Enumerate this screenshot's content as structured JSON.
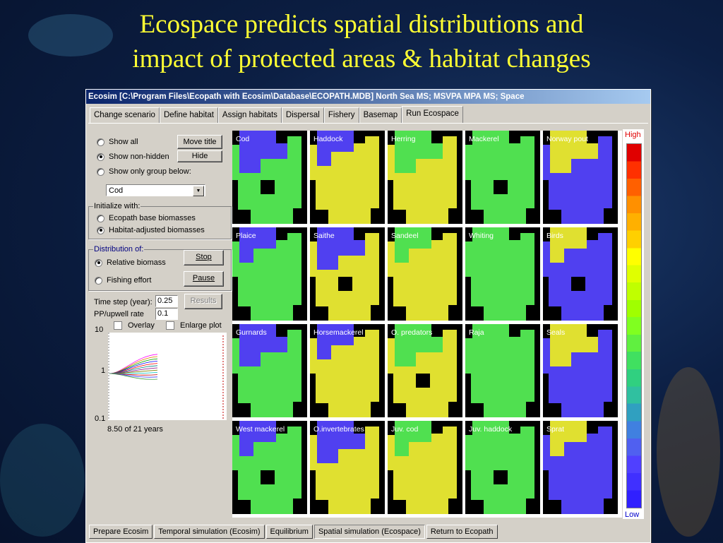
{
  "slide_title": [
    "Ecospace predicts spatial distributions and",
    "impact of protected areas & habitat changes"
  ],
  "window": {
    "title": "Ecosim [C:\\Program Files\\Ecopath with Ecosim\\Database\\ECOPATH.MDB] North Sea MS; MSVPA MPA MS; Space"
  },
  "tabs": [
    {
      "label": "Change scenario",
      "active": false
    },
    {
      "label": "Define habitat",
      "active": false
    },
    {
      "label": "Assign habitats",
      "active": false
    },
    {
      "label": "Dispersal",
      "active": false
    },
    {
      "label": "Fishery",
      "active": false
    },
    {
      "label": "Basemap",
      "active": false
    },
    {
      "label": "Run Ecospace",
      "active": true
    }
  ],
  "display_options": {
    "show_all": "Show all",
    "show_non_hidden": "Show non-hidden",
    "show_only_group": "Show only group below:",
    "selected": "show_non_hidden",
    "move_title_button": "Move title",
    "hide_button": "Hide",
    "group_value": "Cod"
  },
  "initialize": {
    "label": "Initialize with:",
    "ecopath_base": "Ecopath base biomasses",
    "habitat_adjusted": "Habitat-adjusted biomasses",
    "selected": "habitat_adjusted"
  },
  "distribution": {
    "label": "Distribution of:",
    "relative_biomass": "Relative biomass",
    "fishing_effort": "Fishing effort",
    "selected": "relative_biomass",
    "stop_button": "Stop",
    "pause_button": "Pause"
  },
  "params": {
    "time_step_label": "Time step (year):",
    "time_step_value": "0.25",
    "pp_label": "PP/upwell rate",
    "pp_value": "0.1",
    "results_button": "Results"
  },
  "plot": {
    "overlay_label": "Overlay",
    "enlarge_label": "Enlarge plot",
    "y_ticks": [
      "10",
      "1",
      "0.1"
    ],
    "status": "8.50 of 21 years",
    "line_colors": [
      "#ff00ff",
      "#e08000",
      "#00a000",
      "#0000ff",
      "#ff0000",
      "#008080",
      "#800080",
      "#808000",
      "#00c0c0",
      "#c00000",
      "#4040ff",
      "#40a040"
    ]
  },
  "maps": [
    {
      "name": "Cod"
    },
    {
      "name": "Haddock"
    },
    {
      "name": "Herring"
    },
    {
      "name": "Mackerel"
    },
    {
      "name": "Norway pout"
    },
    {
      "name": "Plaice"
    },
    {
      "name": "Saithe"
    },
    {
      "name": "Sandeel"
    },
    {
      "name": "Whiting"
    },
    {
      "name": "Birds"
    },
    {
      "name": "Gurnards"
    },
    {
      "name": "Horsemackerel"
    },
    {
      "name": "O. predators"
    },
    {
      "name": "Raja"
    },
    {
      "name": "Seals"
    },
    {
      "name": "West mackerel"
    },
    {
      "name": "O.invertebrates"
    },
    {
      "name": "Juv. cod"
    },
    {
      "name": "Juv. haddock"
    },
    {
      "name": "Sprat"
    }
  ],
  "legend": {
    "high": "High",
    "low": "Low",
    "colors": [
      "#e00000",
      "#ff3000",
      "#ff6000",
      "#ff9000",
      "#ffb000",
      "#ffd000",
      "#ffff00",
      "#e0ff00",
      "#c0ff00",
      "#a0ff00",
      "#80ff20",
      "#60f040",
      "#40e060",
      "#30d080",
      "#30c0a0",
      "#30a0c0",
      "#4080e0",
      "#5060f0",
      "#5040ff",
      "#4030ff",
      "#3020ff"
    ]
  },
  "bottom_tabs": [
    {
      "label": "Prepare Ecosim",
      "active": false
    },
    {
      "label": "Temporal simulation (Ecosim)",
      "active": false
    },
    {
      "label": "Equilibrium",
      "active": false
    },
    {
      "label": "Spatial simulation (Ecospace)",
      "active": true
    },
    {
      "label": "Return to Ecopath",
      "active": false
    }
  ],
  "colors": {
    "title_yellow": "#ffff33",
    "window_face": "#d4d0c8",
    "map_blue": "#5040f0",
    "map_green": "#50e050",
    "map_yellow": "#e0e030",
    "map_orange": "#f09020"
  }
}
